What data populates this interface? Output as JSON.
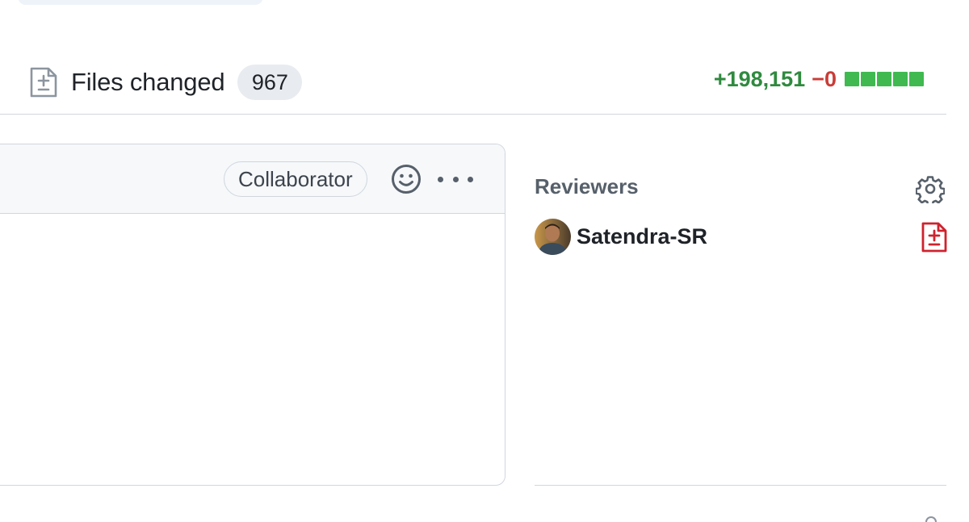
{
  "tab": {
    "icon": "file-diff-icon",
    "label": "Files changed",
    "count": "967"
  },
  "diffstat": {
    "additions": "+198,151",
    "deletions": "−0",
    "blocks": 5,
    "addition_color": "#2f8a3f",
    "deletion_color": "#c93c37",
    "block_color": "#3fb950"
  },
  "comment": {
    "role_badge": "Collaborator",
    "reaction_icon": "smiley-icon",
    "menu_icon": "kebab-horizontal-icon"
  },
  "sidebar": {
    "reviewers": {
      "heading": "Reviewers",
      "settings_icon": "gear-icon",
      "items": [
        {
          "name": "Satendra-SR",
          "avatar": "avatar",
          "status_icon": "file-diff-icon",
          "status_color": "#cf222e"
        }
      ]
    }
  }
}
